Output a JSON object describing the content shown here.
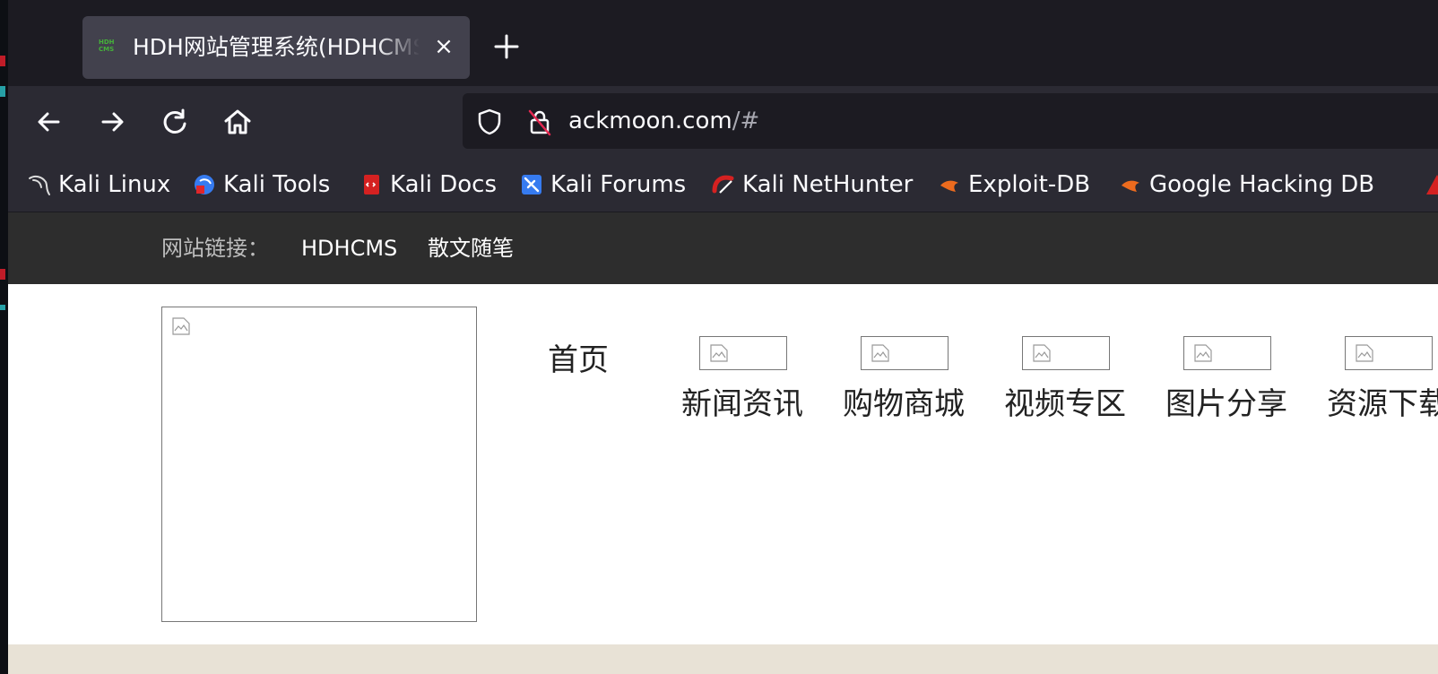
{
  "tab": {
    "title": "HDH网站管理系统(HDHCMS)",
    "favicon_text": "HDH CMS",
    "close_glyph": "×"
  },
  "toolbar": {
    "new_tab_glyph": "+"
  },
  "urlbar": {
    "host": "ackmoon.com",
    "path": "/#"
  },
  "bookmarks": [
    {
      "label": "Kali Linux",
      "icon": "kali-dragon-icon"
    },
    {
      "label": "Kali Tools",
      "icon": "kali-tools-icon"
    },
    {
      "label": "Kali Docs",
      "icon": "kali-docs-icon"
    },
    {
      "label": "Kali Forums",
      "icon": "kali-forums-icon"
    },
    {
      "label": "Kali NetHunter",
      "icon": "kali-nethunter-icon"
    },
    {
      "label": "Exploit-DB",
      "icon": "exploit-db-icon"
    },
    {
      "label": "Google Hacking DB",
      "icon": "ghdb-icon"
    }
  ],
  "page": {
    "links_caption": "网站链接：",
    "links": [
      "HDHCMS",
      "散文随笔"
    ],
    "nav_home": "首页",
    "nav_items": [
      "新闻资讯",
      "购物商城",
      "视频专区",
      "图片分享",
      "资源下载"
    ]
  },
  "colors": {
    "tab_active": "#42414d",
    "toolbar": "#2b2a33",
    "page_topbar": "#2d2d2d",
    "footer_strip": "#e8e2d6"
  }
}
